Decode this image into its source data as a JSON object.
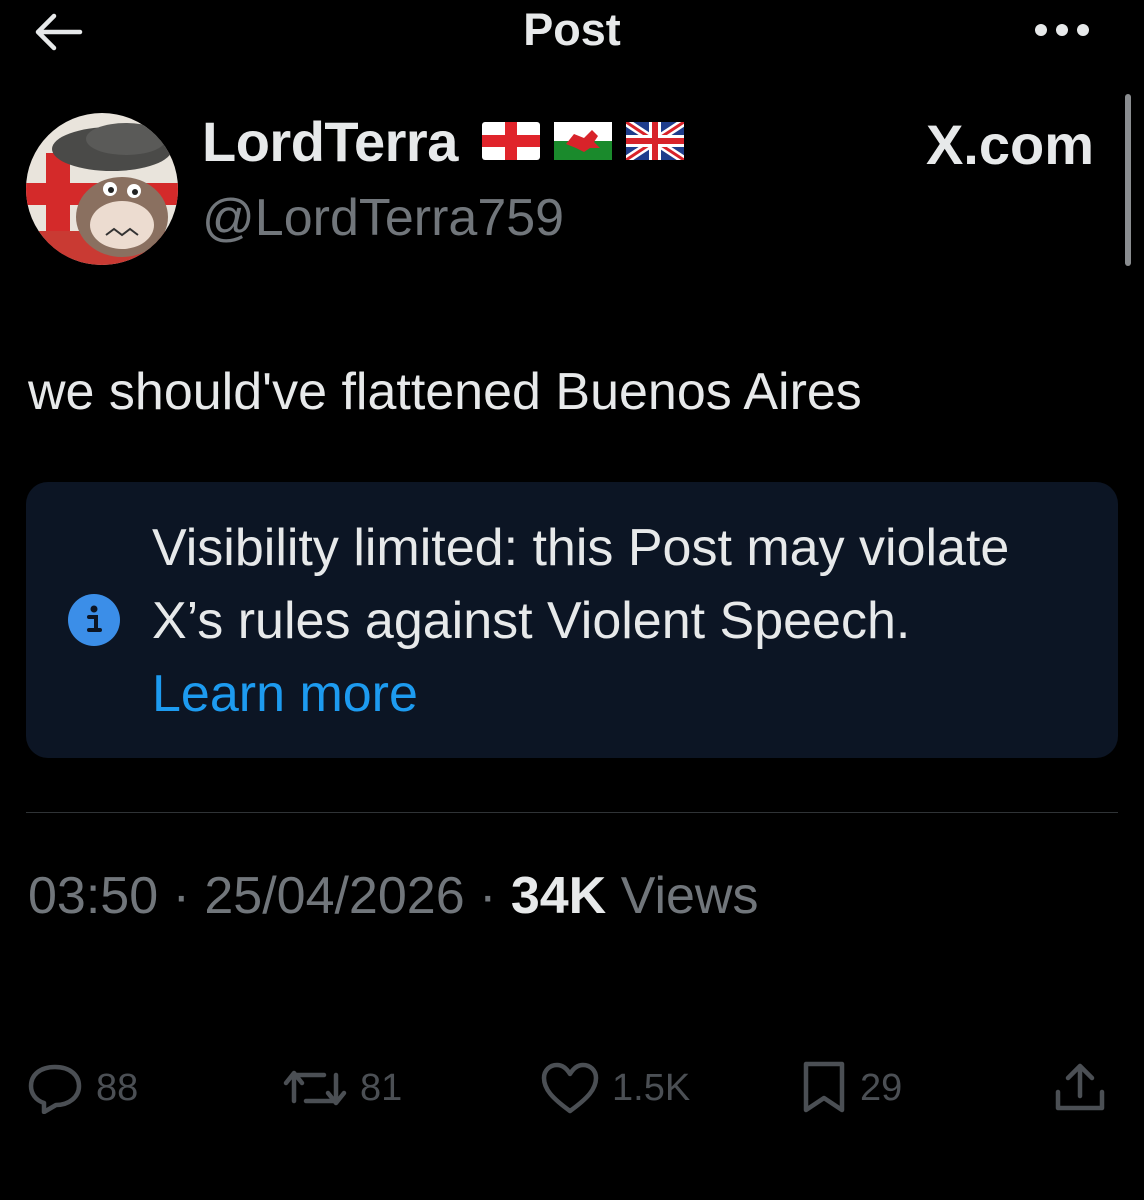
{
  "header": {
    "title": "Post",
    "back_icon": "arrow-left-icon",
    "more_icon": "ellipsis-icon"
  },
  "author": {
    "display_name": "LordTerra",
    "handle": "@LordTerra759",
    "flags": [
      "england-flag-icon",
      "wales-flag-icon",
      "uk-flag-icon"
    ]
  },
  "source_label": "X.com",
  "post": {
    "text": "we should've flattened Buenos Aires"
  },
  "notice": {
    "text": "Visibility limited: this Post may violate X’s rules against Violent Speech.",
    "link_text": "Learn more",
    "icon": "info-icon"
  },
  "meta": {
    "time": "03:50",
    "separator": " · ",
    "date": "25/04/2026",
    "views_count": "34K",
    "views_label": " Views"
  },
  "actions": {
    "replies": "88",
    "reposts": "81",
    "likes": "1.5K",
    "bookmarks": "29"
  },
  "colors": {
    "background": "#000000",
    "text_primary": "#e7e9ea",
    "text_secondary": "#71767b",
    "accent": "#1d9bf0",
    "notice_bg": "#0c1524"
  }
}
